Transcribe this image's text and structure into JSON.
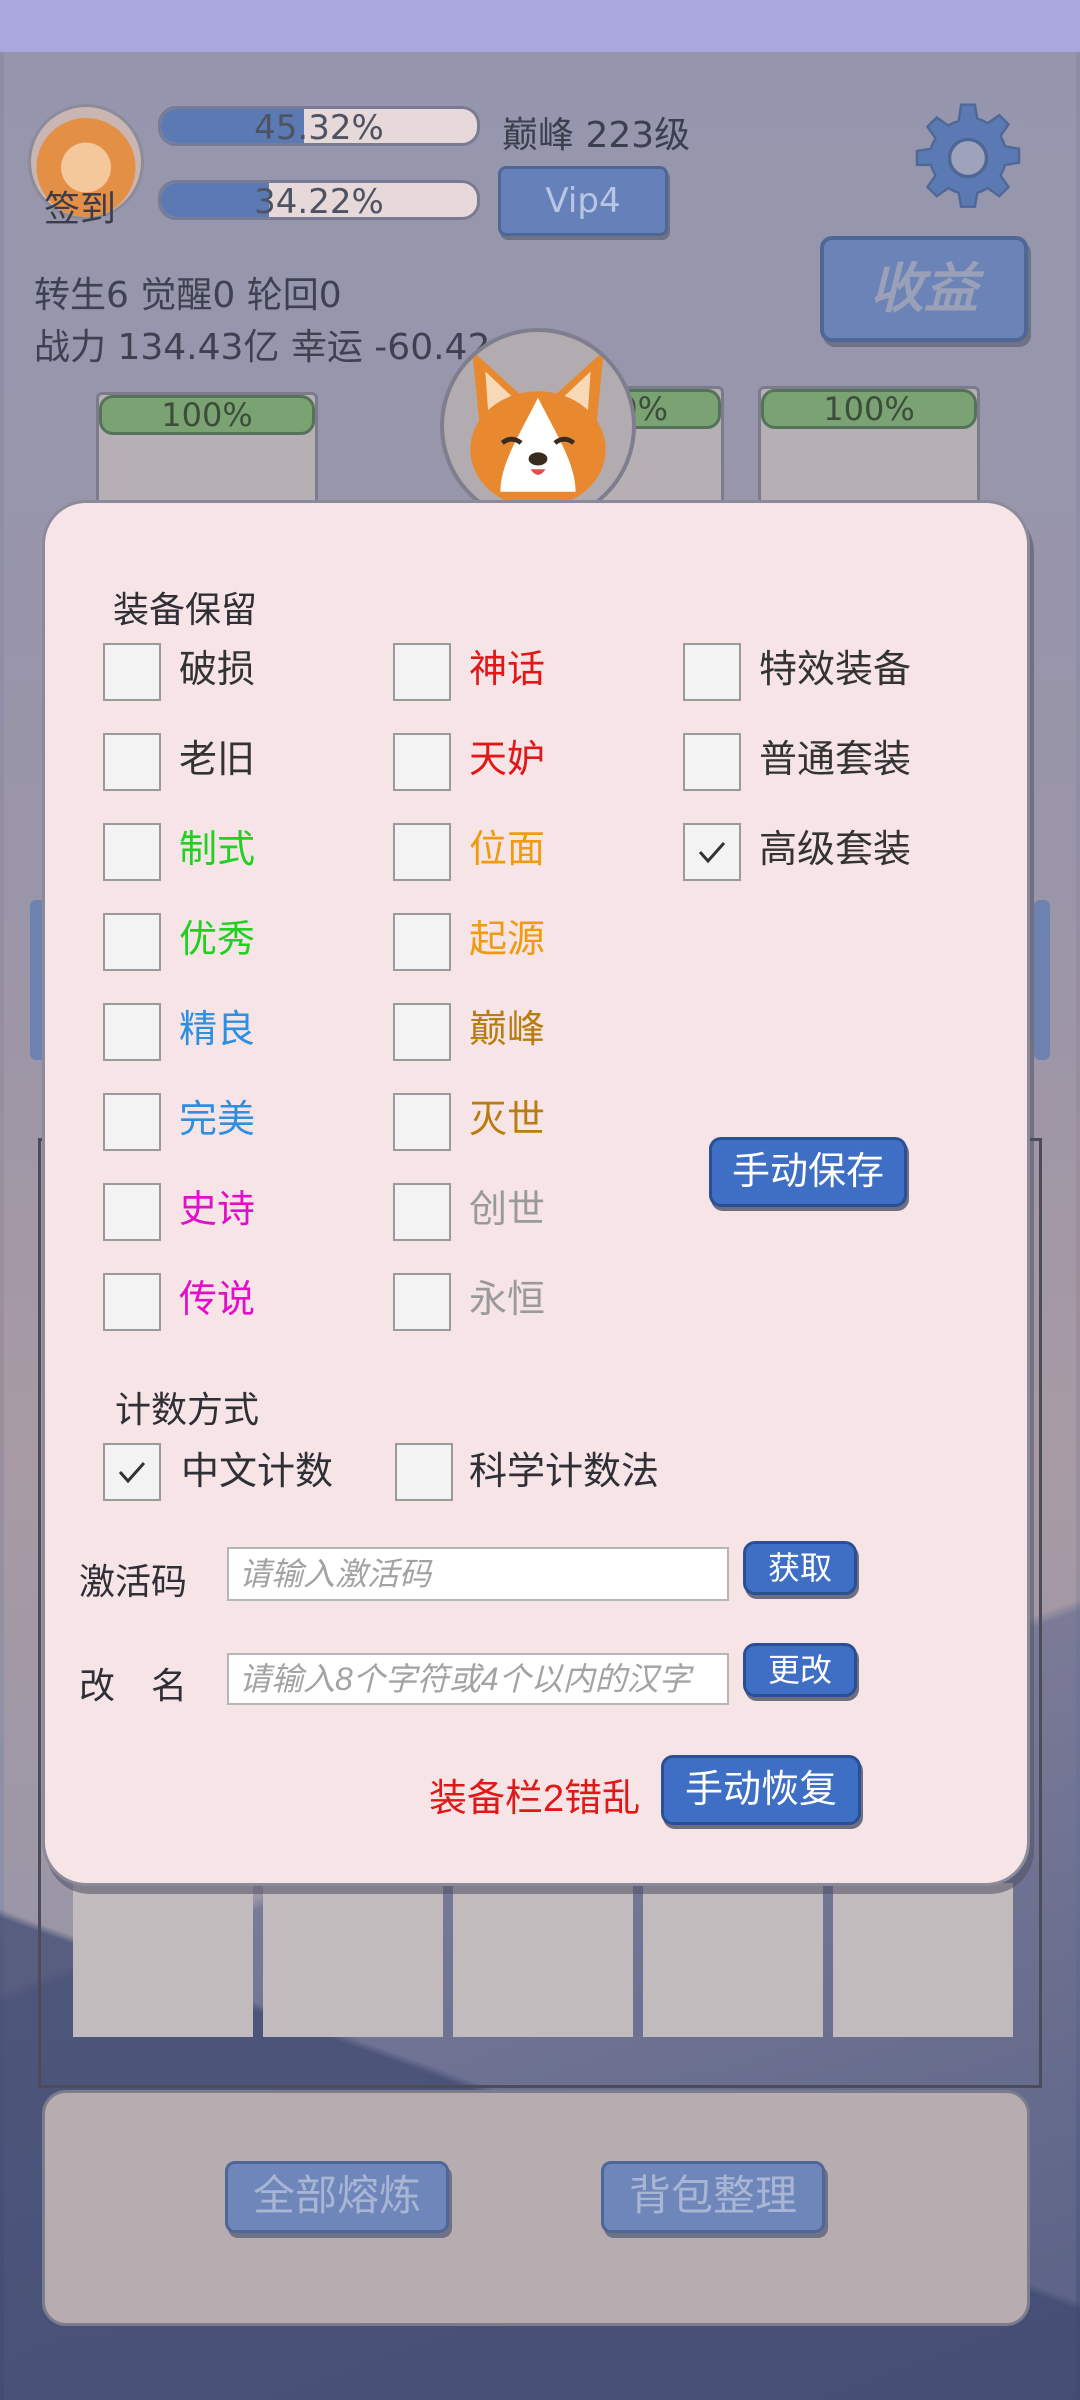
{
  "hud": {
    "signin_label": "签到",
    "exp_bar_text": "45.32%",
    "exp_progress": 0.4532,
    "second_bar_text": "34.22%",
    "second_progress": 0.3422,
    "level_text": "巅峰 223级",
    "vip_label": "Vip4",
    "income_label": "收益",
    "rebirth_line": "转生6 觉醒0 轮回0",
    "power_line": "战力 134.43亿  幸运 -60.42",
    "slot_percents": [
      "100%",
      "00%",
      "100%"
    ]
  },
  "dialog": {
    "equip_keep_title": "装备保留",
    "options": [
      {
        "label": "破损",
        "color": "#333333",
        "checked": false
      },
      {
        "label": "神话",
        "color": "#e01818",
        "checked": false
      },
      {
        "label": "特效装备",
        "color": "#333333",
        "checked": false
      },
      {
        "label": "老旧",
        "color": "#333333",
        "checked": false
      },
      {
        "label": "天妒",
        "color": "#e01818",
        "checked": false
      },
      {
        "label": "普通套装",
        "color": "#333333",
        "checked": false
      },
      {
        "label": "制式",
        "color": "#22d022",
        "checked": false
      },
      {
        "label": "位面",
        "color": "#f09a10",
        "checked": false
      },
      {
        "label": "高级套装",
        "color": "#333333",
        "checked": true
      },
      {
        "label": "优秀",
        "color": "#22d022",
        "checked": false
      },
      {
        "label": "起源",
        "color": "#f09a10",
        "checked": false
      },
      {
        "label": "精良",
        "color": "#2e8fe0",
        "checked": false
      },
      {
        "label": "巅峰",
        "color": "#b87c10",
        "checked": false
      },
      {
        "label": "完美",
        "color": "#2e8fe0",
        "checked": false
      },
      {
        "label": "灭世",
        "color": "#b87c10",
        "checked": false
      },
      {
        "label": "史诗",
        "color": "#e010c8",
        "checked": false
      },
      {
        "label": "创世",
        "color": "#9a9a9a",
        "checked": false
      },
      {
        "label": "传说",
        "color": "#e010c8",
        "checked": false
      },
      {
        "label": "永恒",
        "color": "#9a9a9a",
        "checked": false
      }
    ],
    "manual_save_label": "手动保存",
    "count_title": "计数方式",
    "count_options": [
      {
        "label": "中文计数",
        "checked": true
      },
      {
        "label": "科学计数法",
        "checked": false
      }
    ],
    "activation": {
      "label": "激活码",
      "placeholder": "请输入激活码",
      "value": "",
      "button": "获取"
    },
    "rename": {
      "label": "改　名",
      "placeholder": "请输入8个字符或4个以内的汉字",
      "value": "",
      "button": "更改"
    },
    "warning_text": "装备栏2错乱",
    "warning_color": "#e01818",
    "restore_label": "手动恢复"
  },
  "bottom": {
    "smelt_all_label": "全部熔炼",
    "sort_bag_label": "背包整理"
  }
}
